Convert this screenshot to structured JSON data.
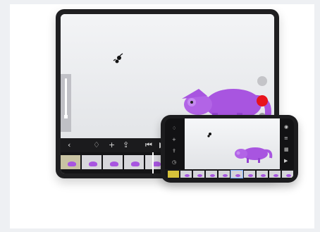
{
  "colors": {
    "record": "#e8131b",
    "chameleon": "#a855e0",
    "accent": "#ffffff"
  },
  "tablet": {
    "toolbar_icons": [
      "back-icon",
      "brush-icon",
      "add-icon",
      "export-icon",
      "skip-start-icon",
      "play-icon"
    ],
    "toolbar_glyphs": [
      "‹",
      "♢",
      "+",
      "⇪",
      "⏮",
      "▶"
    ],
    "frame_count": 6
  },
  "phone": {
    "left_icons": [
      "brush-icon",
      "add-icon",
      "export-icon",
      "timer-icon"
    ],
    "left_glyphs": [
      "♢",
      "+",
      "⇪",
      "◷"
    ],
    "right_icons": [
      "camera-icon",
      "ghost-icon",
      "grid-icon",
      "play-icon"
    ],
    "right_glyphs": [
      "◉",
      "≡",
      "▦",
      "▶"
    ],
    "frame_count": 10
  }
}
